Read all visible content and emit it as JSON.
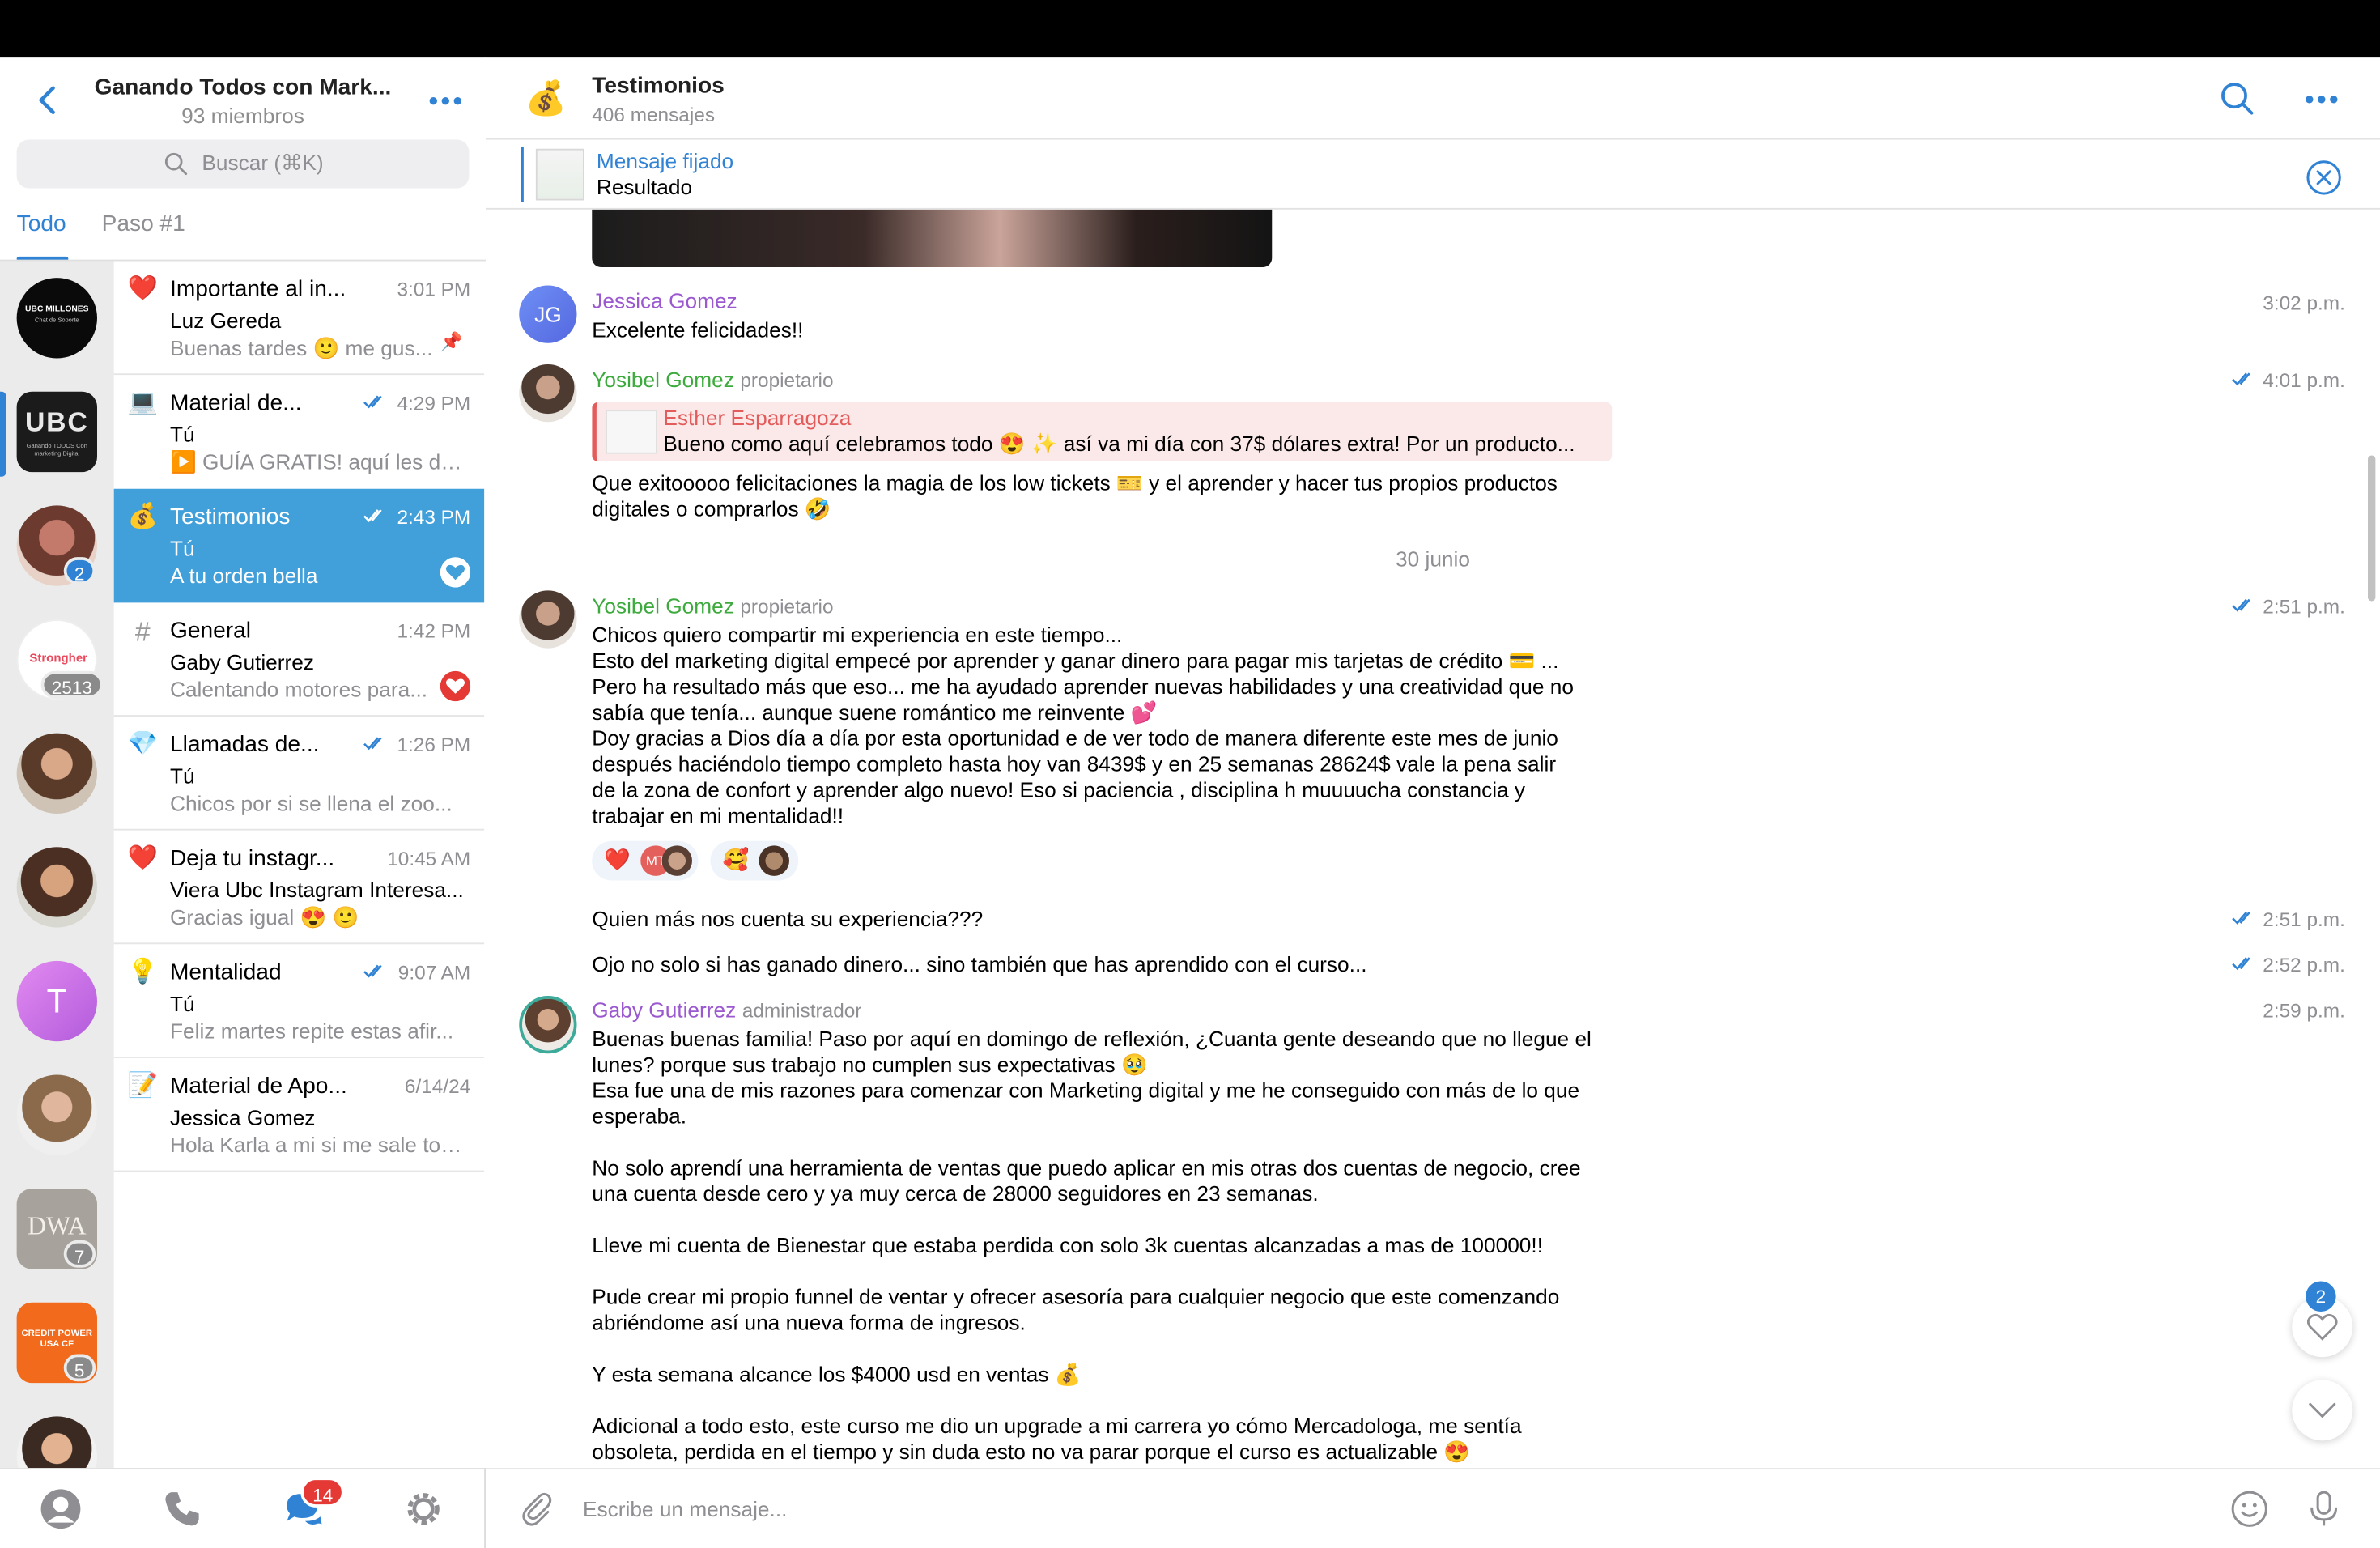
{
  "group": {
    "title": "Ganando Todos con Mark...",
    "members": "93 miembros"
  },
  "search": {
    "placeholder": "Buscar (⌘K)"
  },
  "tabs": [
    "Todo",
    "Paso #1"
  ],
  "rail": {
    "items": [
      {
        "name": "UBC MILLONES",
        "sub": "Chat de Soporte",
        "badge": ""
      },
      {
        "name": "UBC",
        "sub": "Ganando TODOS Con marketing Digital",
        "badge": ""
      },
      {
        "name": "",
        "sub": "",
        "badge": "2"
      },
      {
        "name": "Strongher",
        "sub": "",
        "badge": "2513"
      },
      {
        "name": "",
        "sub": "",
        "badge": ""
      },
      {
        "name": "",
        "sub": "",
        "badge": ""
      },
      {
        "name": "T",
        "sub": "",
        "badge": ""
      },
      {
        "name": "",
        "sub": "",
        "badge": ""
      },
      {
        "name": "DWA",
        "sub": "",
        "badge": "7"
      },
      {
        "name": "CREDIT POWER USA CF",
        "sub": "",
        "badge": "5"
      },
      {
        "name": "",
        "sub": "",
        "badge": ""
      }
    ]
  },
  "chats": [
    {
      "emoji": "❤️",
      "title": "Importante al in...",
      "time": "3:01 PM",
      "sender": "Luz Gereda",
      "preview": "Buenas tardes 🙂 me gus...",
      "pinned": true,
      "read": false
    },
    {
      "emoji": "💻",
      "title": "Material de...",
      "time": "4:29 PM",
      "sender": "Tú",
      "preview": "▶️ GUÍA GRATIS! aquí les dej...",
      "pinned": false,
      "read": true
    },
    {
      "emoji": "💰",
      "title": "Testimonios",
      "time": "2:43 PM",
      "sender": "Tú",
      "preview": "A tu orden bella",
      "pinned": false,
      "read": true
    },
    {
      "emoji": "#",
      "title": "General",
      "time": "1:42 PM",
      "sender": "Gaby Gutierrez",
      "preview": "Calentando motores para...",
      "pinned": false,
      "read": false
    },
    {
      "emoji": "💎",
      "title": "Llamadas de...",
      "time": "1:26 PM",
      "sender": "Tú",
      "preview": "Chicos por si se llena el zoo...",
      "pinned": false,
      "read": true
    },
    {
      "emoji": "❤️",
      "title": "Deja tu instagr...",
      "time": "10:45 AM",
      "sender": "Viera Ubc Instagram Interesa...",
      "preview": "Gracias igual 😍 🙂",
      "pinned": false,
      "read": false
    },
    {
      "emoji": "💡",
      "title": "Mentalidad",
      "time": "9:07 AM",
      "sender": "Tú",
      "preview": "Feliz martes repite estas afir...",
      "pinned": false,
      "read": true
    },
    {
      "emoji": "📝",
      "title": "Material de Apo...",
      "time": "6/14/24",
      "sender": "Jessica Gomez",
      "preview": "Hola Karla a mi si me sale tod...",
      "pinned": false,
      "read": false
    }
  ],
  "nav": {
    "chats_badge": "14"
  },
  "topic": {
    "icon": "💰",
    "title": "Testimonios",
    "count": "406 mensajes"
  },
  "pinned": {
    "title": "Mensaje fijado",
    "text": "Resultado"
  },
  "messages": [
    {
      "initials": "JG",
      "name": "Jessica Gomez",
      "role": "",
      "time": "3:02 p.m.",
      "text": "Excelente felicidades!!"
    },
    {
      "name": "Yosibel Gomez",
      "role": "propietario",
      "time": "4:01 p.m.",
      "reply_name": "Esther Esparragoza",
      "reply_text": "Bueno como aquí celebramos todo 😍 ✨  así va mi día con 37$ dólares extra! Por un producto...",
      "text": "Que exitooooo felicitaciones la magia de los low tickets 🎫 y el aprender y hacer tus propios productos digitales o comprarlos 🤣"
    },
    {
      "date": "30 junio"
    },
    {
      "name": "Yosibel Gomez",
      "role": "propietario",
      "time": "2:51 p.m.",
      "lines": [
        "Chicos quiero compartir mi experiencia en este tiempo...",
        "Esto del marketing digital empecé por aprender y ganar dinero para pagar mis tarjetas de crédito 💳 ...",
        "Pero ha resultado más que eso... me ha ayudado aprender nuevas habilidades y una creatividad que no",
        "sabía que tenía... aunque suene romántico me reinvente 💕",
        "Doy gracias a Dios día a día por esta oportunidad e de ver todo de manera diferente este mes de junio",
        "después haciéndolo tiempo completo hasta hoy van 8439$ y en 25 semanas 28624$  vale la pena salir",
        "de la zona de confort y aprender algo nuevo! Eso si paciencia , disciplina h muuuucha constancia y",
        "trabajar en mi mentalidad!!"
      ],
      "reactions": [
        {
          "emoji": "❤️",
          "initials": "MT"
        },
        {
          "emoji": "🥰",
          "initials": ""
        }
      ]
    },
    {
      "time": "2:51 p.m.",
      "text": "Quien más nos cuenta su experiencia???"
    },
    {
      "time": "2:52 p.m.",
      "text": "Ojo no solo si has ganado dinero... sino también que has aprendido con el curso..."
    },
    {
      "name": "Gaby Gutierrez",
      "role": "administrador",
      "time": "2:59 p.m.",
      "lines": [
        "Buenas buenas familia! Paso por aquí en domingo de reflexión, ¿Cuanta gente deseando que no llegue el",
        "lunes? porque sus trabajo no cumplen sus expectativas 🥹",
        "Esa fue una de mis razones para comenzar con Marketing digital y me he conseguido con más de lo que",
        "esperaba.",
        "",
        "No solo aprendí una herramienta de ventas que puedo aplicar en mis otras dos cuentas de negocio, cree",
        "una cuenta desde cero y ya muy cerca de 28000 seguidores en 23 semanas.",
        "",
        "Lleve mi cuenta de Bienestar que estaba perdida con solo 3k cuentas alcanzadas a mas de 100000!!",
        "",
        "Pude crear mi propio funnel de ventar y ofrecer asesoría para cualquier negocio que este comenzando",
        "abriéndome así una nueva forma de ingresos.",
        "",
        "Y esta semana alcance los           $4000 usd en ventas 💰",
        "",
        "Adicional a todo esto, este curso me dio un upgrade a mi carrera yo cómo Mercadologa, me sentía",
        "obsoleta, perdida en el tiempo y sin duda esto no va parar porque el curso es actualizable 😍"
      ]
    }
  ],
  "fab": {
    "reactions_badge": "2"
  },
  "composer": {
    "placeholder": "Escribe un mensaje..."
  },
  "colors": {
    "accent": "#2f82d4",
    "active_chat": "#419fd9",
    "name_purple": "#9b59d0",
    "name_green": "#3daa3d",
    "reply_red": "#e35b5b",
    "badge_red": "#e53935"
  }
}
